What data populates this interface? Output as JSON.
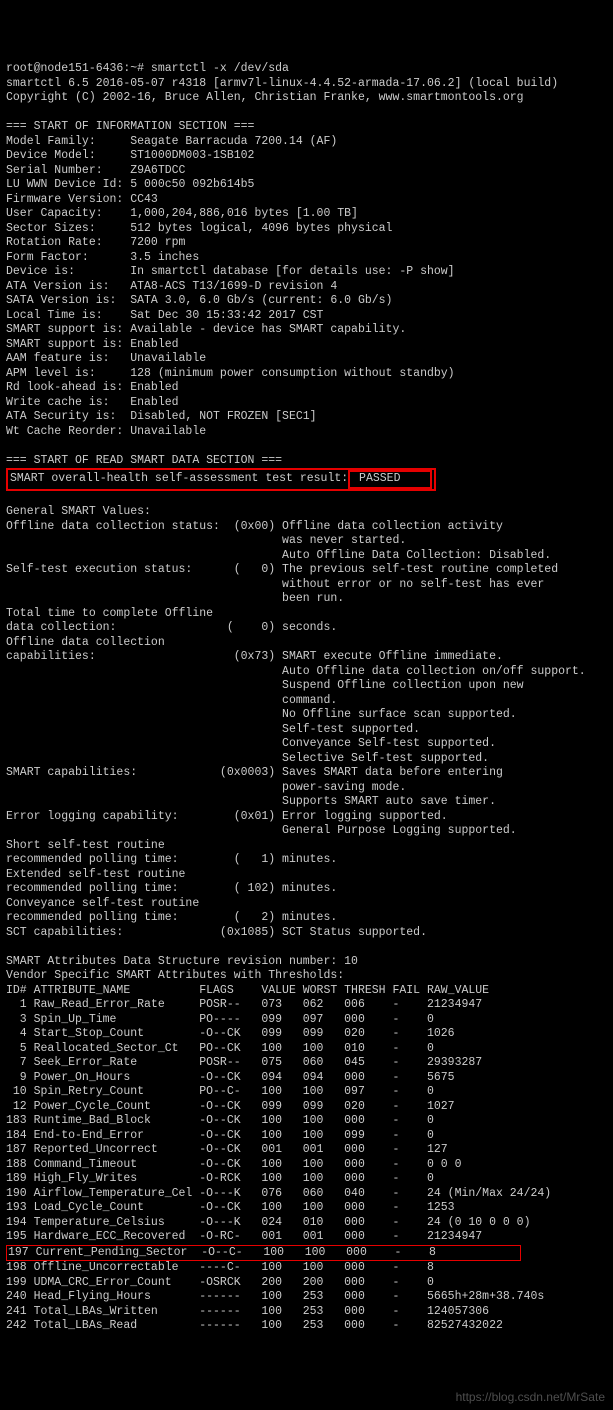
{
  "prompt": "root@node151-6436:~# smartctl -x /dev/sda",
  "version_line": "smartctl 6.5 2016-05-07 r4318 [armv7l-linux-4.4.52-armada-17.06.2] (local build)",
  "copyright": "Copyright (C) 2002-16, Bruce Allen, Christian Franke, www.smartmontools.org",
  "section1_header": "=== START OF INFORMATION SECTION ===",
  "info": {
    "model_family": "Model Family:     Seagate Barracuda 7200.14 (AF)",
    "device_model": "Device Model:     ST1000DM003-1SB102",
    "serial_number": "Serial Number:    Z9A6TDCC",
    "lu_wwn": "LU WWN Device Id: 5 000c50 092b614b5",
    "firmware": "Firmware Version: CC43",
    "user_capacity": "User Capacity:    1,000,204,886,016 bytes [1.00 TB]",
    "sector_sizes": "Sector Sizes:     512 bytes logical, 4096 bytes physical",
    "rotation_rate": "Rotation Rate:    7200 rpm",
    "form_factor": "Form Factor:      3.5 inches",
    "device_is": "Device is:        In smartctl database [for details use: -P show]",
    "ata_version": "ATA Version is:   ATA8-ACS T13/1699-D revision 4",
    "sata_version": "SATA Version is:  SATA 3.0, 6.0 Gb/s (current: 6.0 Gb/s)",
    "local_time": "Local Time is:    Sat Dec 30 15:33:42 2017 CST",
    "smart_support1": "SMART support is: Available - device has SMART capability.",
    "smart_support2": "SMART support is: Enabled",
    "aam": "AAM feature is:   Unavailable",
    "apm": "APM level is:     128 (minimum power consumption without standby)",
    "rd_lookahead": "Rd look-ahead is: Enabled",
    "write_cache": "Write cache is:   Enabled",
    "ata_security": "ATA Security is:  Disabled, NOT FROZEN [SEC1]",
    "wt_cache_reorder": "Wt Cache Reorder: Unavailable"
  },
  "section2_header": "=== START OF READ SMART DATA SECTION ===",
  "health_label": "SMART overall-health self-assessment test result:",
  "health_value": " PASSED    ",
  "general_header": "General SMART Values:",
  "g": {
    "offline1": "Offline data collection status:  (0x00) Offline data collection activity",
    "offline2": "                                        was never started.",
    "offline3": "                                        Auto Offline Data Collection: Disabled.",
    "selftest1": "Self-test execution status:      (   0) The previous self-test routine completed",
    "selftest2": "                                        without error or no self-test has ever",
    "selftest3": "                                        been run.",
    "total1": "Total time to complete Offline",
    "total2": "data collection:                (    0) seconds.",
    "cap0": "Offline data collection",
    "cap1": "capabilities:                    (0x73) SMART execute Offline immediate.",
    "cap2": "                                        Auto Offline data collection on/off support.",
    "cap3": "                                        Suspend Offline collection upon new",
    "cap4": "                                        command.",
    "cap5": "                                        No Offline surface scan supported.",
    "cap6": "                                        Self-test supported.",
    "cap7": "                                        Conveyance Self-test supported.",
    "cap8": "                                        Selective Self-test supported.",
    "smart1": "SMART capabilities:            (0x0003) Saves SMART data before entering",
    "smart2": "                                        power-saving mode.",
    "smart3": "                                        Supports SMART auto save timer.",
    "err1": "Error logging capability:        (0x01) Error logging supported.",
    "err2": "                                        General Purpose Logging supported.",
    "short1": "Short self-test routine",
    "short2": "recommended polling time:        (   1) minutes.",
    "ext1": "Extended self-test routine",
    "ext2": "recommended polling time:        ( 102) minutes.",
    "conv1": "Conveyance self-test routine",
    "conv2": "recommended polling time:        (   2) minutes.",
    "sct": "SCT capabilities:              (0x1085) SCT Status supported."
  },
  "attr_header1": "SMART Attributes Data Structure revision number: 10",
  "attr_header2": "Vendor Specific SMART Attributes with Thresholds:",
  "attr_cols": "ID# ATTRIBUTE_NAME          FLAGS    VALUE WORST THRESH FAIL RAW_VALUE",
  "attrs": [
    "  1 Raw_Read_Error_Rate     POSR--   073   062   006    -    21234947",
    "  3 Spin_Up_Time            PO----   099   097   000    -    0",
    "  4 Start_Stop_Count        -O--CK   099   099   020    -    1026",
    "  5 Reallocated_Sector_Ct   PO--CK   100   100   010    -    0",
    "  7 Seek_Error_Rate         POSR--   075   060   045    -    29393287",
    "  9 Power_On_Hours          -O--CK   094   094   000    -    5675",
    " 10 Spin_Retry_Count        PO--C-   100   100   097    -    0",
    " 12 Power_Cycle_Count       -O--CK   099   099   020    -    1027",
    "183 Runtime_Bad_Block       -O--CK   100   100   000    -    0",
    "184 End-to-End_Error        -O--CK   100   100   099    -    0",
    "187 Reported_Uncorrect      -O--CK   001   001   000    -    127",
    "188 Command_Timeout         -O--CK   100   100   000    -    0 0 0",
    "189 High_Fly_Writes         -O-RCK   100   100   000    -    0",
    "190 Airflow_Temperature_Cel -O---K   076   060   040    -    24 (Min/Max 24/24)",
    "193 Load_Cycle_Count        -O--CK   100   100   000    -    1253",
    "194 Temperature_Celsius     -O---K   024   010   000    -    24 (0 10 0 0 0)",
    "195 Hardware_ECC_Recovered  -O-RC-   001   001   000    -    21234947"
  ],
  "attr_highlight": "197 Current_Pending_Sector  -O--C-   100   100   000    -    8            ",
  "attrs2": [
    "198 Offline_Uncorrectable   ----C-   100   100   000    -    8",
    "199 UDMA_CRC_Error_Count    -OSRCK   200   200   000    -    0",
    "240 Head_Flying_Hours       ------   100   253   000    -    5665h+28m+38.740s",
    "241 Total_LBAs_Written      ------   100   253   000    -    124057306",
    "242 Total_LBAs_Read         ------   100   253   000    -    82527432022"
  ],
  "watermark": "https://blog.csdn.net/MrSate"
}
